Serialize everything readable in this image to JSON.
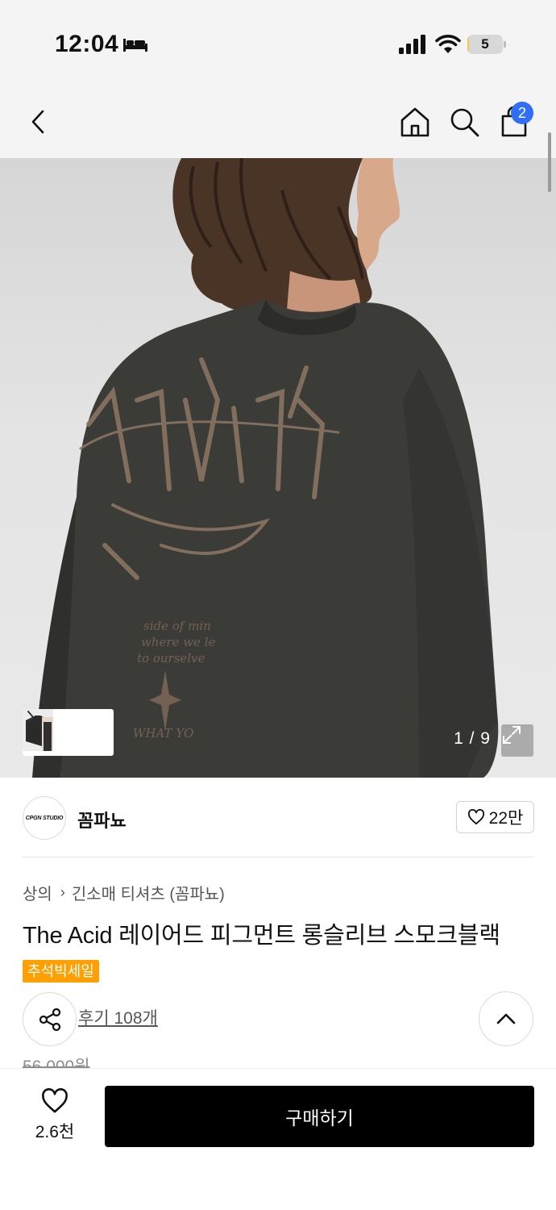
{
  "status_bar": {
    "time": "12:04",
    "battery_level": "5",
    "battery_fraction": 0.05,
    "icons": [
      "bed-icon",
      "signal-icon",
      "wifi-icon",
      "battery-icon"
    ]
  },
  "nav": {
    "icons": [
      "back-icon",
      "home-icon",
      "search-icon",
      "cart-icon"
    ],
    "cart_badge": "2"
  },
  "gallery": {
    "page_counter": "1 / 9",
    "thumbnail_count": 2,
    "icons": [
      "chevron-right-icon",
      "expand-icon"
    ]
  },
  "brand": {
    "logo_text": "CPGN STUDIO",
    "name": "꼼파뇨",
    "like_count": "22만",
    "icon": "heart-icon"
  },
  "product": {
    "breadcrumb": [
      "상의",
      "긴소매 티셔츠 (꼼파뇨)"
    ],
    "title": "The Acid 레이어드 피그먼트 롱슬리브 스모크블랙",
    "sale_badge": "추석빅세일",
    "review_link": "후기 108개",
    "original_price": "56,000원"
  },
  "bottom_bar": {
    "wish_count": "2.6천",
    "buy_label": "구매하기"
  },
  "colors": {
    "cart_badge": "#2f6ef5",
    "sale_badge": "#ff9f00",
    "buy_button": "#000000",
    "background": "#f4f4f4"
  }
}
